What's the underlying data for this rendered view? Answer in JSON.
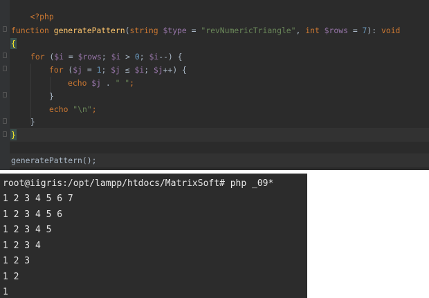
{
  "editor": {
    "open_tag": "<?php",
    "func_keyword": "function",
    "func_name": "generatePattern",
    "paren_open": "(",
    "param1_type": "string",
    "param1_var": "$type",
    "param1_eq": " = ",
    "param1_default": "\"revNumericTriangle\"",
    "comma": ", ",
    "param2_type": "int",
    "param2_var": "$rows",
    "param2_eq": " = ",
    "param2_default": "7",
    "paren_close_colon": "): ",
    "return_type": "void",
    "open_brace": "{",
    "for1": {
      "kw": "for",
      "p1": " (",
      "v1": "$i",
      "p2": " = ",
      "v2": "$rows",
      "p3": "; ",
      "v3": "$i",
      "p4": " > ",
      "n": "0",
      "p5": "; ",
      "v4": "$i",
      "p6": "--) {"
    },
    "for2": {
      "kw": "for",
      "p1": " (",
      "v1": "$j",
      "p2": " = ",
      "n": "1",
      "p3": "; ",
      "v2": "$j",
      "p4": " ≤ ",
      "v3": "$i",
      "p5": "; ",
      "v4": "$j",
      "p6": "++) {"
    },
    "echo1": {
      "kw": "echo",
      "sp": " ",
      "var": "$j",
      "op": " . ",
      "str": "\" \"",
      "end": ";"
    },
    "inner_close": "}",
    "echo2": {
      "kw": "echo",
      "sp": " ",
      "str": "\"\\n\"",
      "end": ";"
    },
    "outer_close": "}",
    "func_close": "}",
    "call": "generatePattern();"
  },
  "terminal": {
    "lines": [
      "root@iigris:/opt/lampp/htdocs/MatrixSoft# php _09*",
      "1 2 3 4 5 6 7",
      "1 2 3 4 5 6",
      "1 2 3 4 5",
      "1 2 3 4",
      "1 2 3",
      "1 2",
      "1"
    ]
  }
}
